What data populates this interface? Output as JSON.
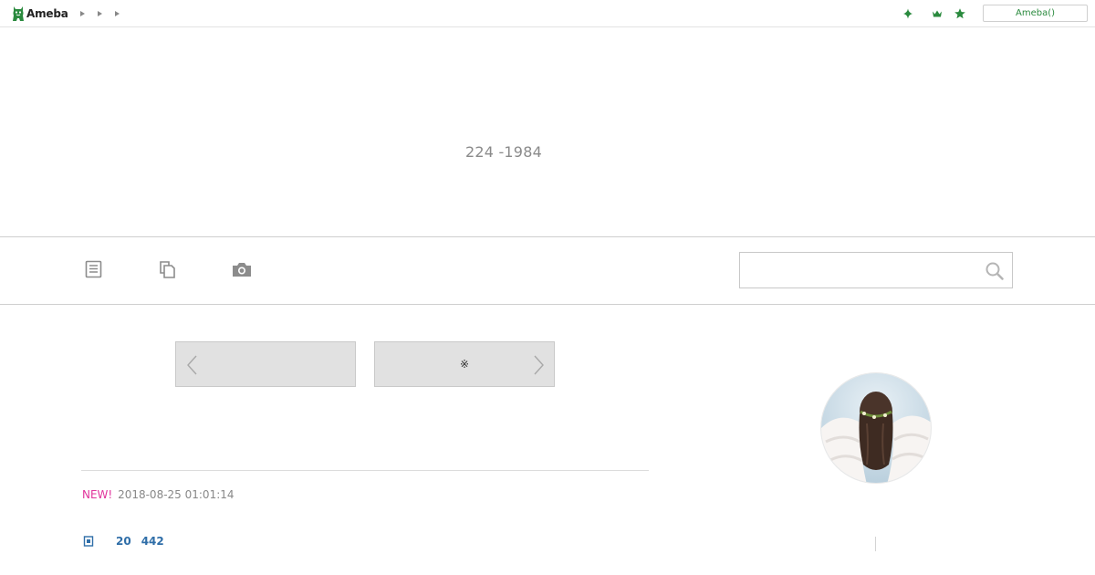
{
  "topbar": {
    "logo_text": "Ameba",
    "breadcrumb_icons": [
      "chevron-right-icon",
      "chevron-right-icon",
      "chevron-right-icon"
    ],
    "icons": [
      "sparkle-icon",
      "crown-icon",
      "star-icon"
    ],
    "login_label": "Ameba()"
  },
  "header": {
    "title": "224 -1984"
  },
  "nav": {
    "icons": [
      "entry-list-icon",
      "theme-list-icon",
      "photo-camera-icon"
    ],
    "search": {
      "value": "",
      "placeholder": "",
      "icon": "search-icon"
    }
  },
  "pager": {
    "prev_label": "",
    "next_label": "※"
  },
  "entry": {
    "new_badge": "NEW!",
    "date": "2018-08-25 01:01:14",
    "stats_icon": "reblog-icon",
    "stat_1": "20",
    "stat_2": "442"
  },
  "profile": {
    "avatar_icon": "profile-photo"
  },
  "colors": {
    "accent_green": "#2a8a3e",
    "new_badge": "#e0339b",
    "link_blue": "#2f6ea8",
    "pager_bg": "#e1e1e1"
  }
}
